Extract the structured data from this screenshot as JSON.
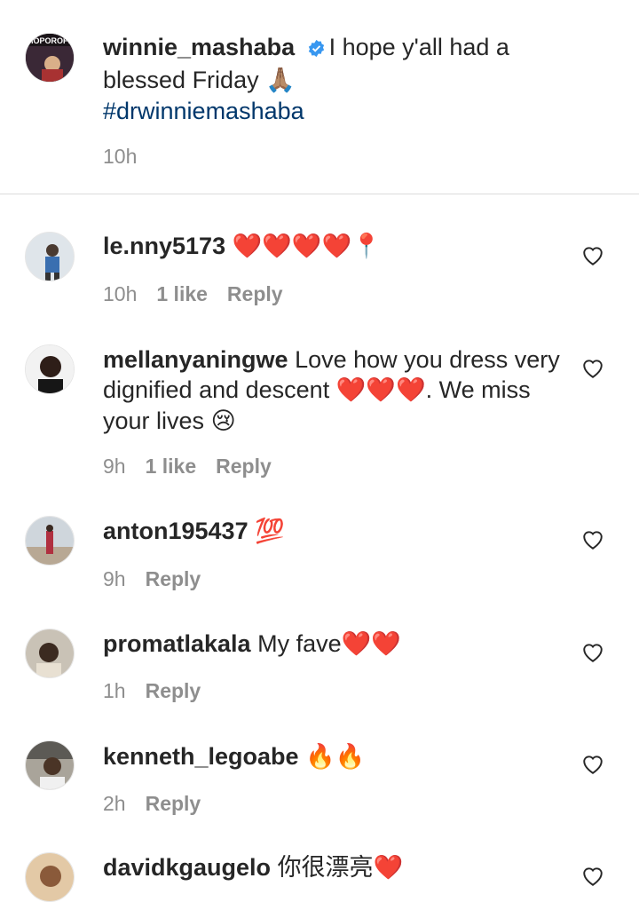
{
  "caption": {
    "username": "winnie_mashaba",
    "text": "I hope y'all had a blessed Friday",
    "emoji": "🙏🏽",
    "hashtag": "#drwinniemashaba",
    "time": "10h",
    "avatar_text": "MOPOROFETI"
  },
  "comments": [
    {
      "username": "le.nny5173",
      "text": "",
      "emoji": "❤️❤️❤️❤️📍",
      "time": "10h",
      "likes": "1 like",
      "reply": "Reply"
    },
    {
      "username": "mellanyaningwe",
      "text": "Love how you dress very dignified and descent",
      "emoji": "❤️❤️❤️",
      "text2": ". We miss your lives",
      "emoji2": "😢",
      "time": "9h",
      "likes": "1 like",
      "reply": "Reply"
    },
    {
      "username": "anton195437",
      "text": "",
      "emoji": "💯",
      "time": "9h",
      "likes": "",
      "reply": "Reply"
    },
    {
      "username": "promatlakala",
      "text": "My fave",
      "emoji": "❤️❤️",
      "time": "1h",
      "likes": "",
      "reply": "Reply"
    },
    {
      "username": "kenneth_legoabe",
      "text": "",
      "emoji": "🔥🔥",
      "time": "2h",
      "likes": "",
      "reply": "Reply"
    },
    {
      "username": "davidkgaugelo",
      "text": "你很漂亮",
      "emoji": "❤️",
      "time": "",
      "likes": "",
      "reply": ""
    }
  ],
  "colors": {
    "hashtag": "#00376b",
    "verified": "#3897f0",
    "meta": "#8e8e8e",
    "heart": "#e0245e"
  }
}
